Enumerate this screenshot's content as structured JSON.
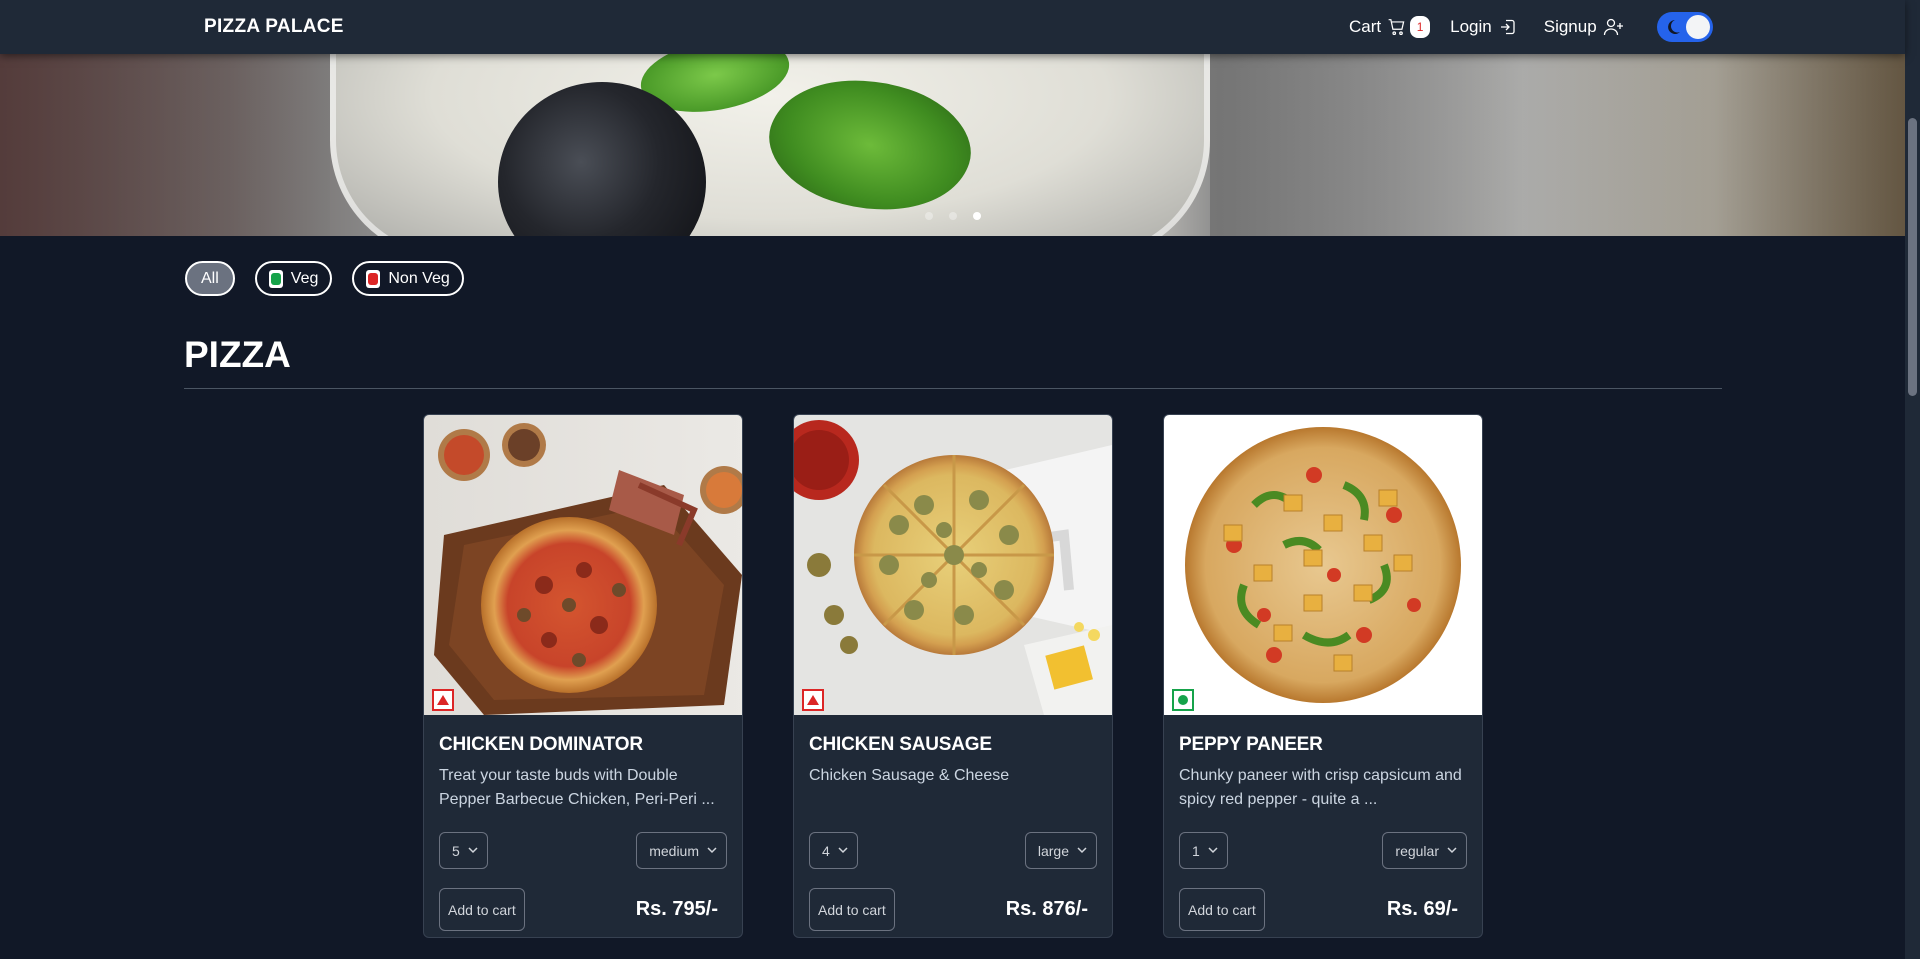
{
  "app": {
    "brand": "PIZZA PALACE"
  },
  "nav": {
    "cart_label": "Cart",
    "cart_count": "1",
    "login_label": "Login",
    "signup_label": "Signup",
    "theme_toggle": "dark"
  },
  "carousel": {
    "slide_count": 3,
    "active_index": 2
  },
  "filters": [
    {
      "label": "All",
      "active": true
    },
    {
      "label": "Veg",
      "mark": "veg"
    },
    {
      "label": "Non Veg",
      "mark": "nonveg"
    }
  ],
  "section": {
    "title": "PIZZA"
  },
  "products": [
    {
      "name": "CHICKEN DOMINATOR",
      "description": "Treat your taste buds with Double Pepper Barbecue Chicken, Peri-Peri ...",
      "quantity": "5",
      "size": "medium",
      "add_label": "Add to cart",
      "price": "Rs. 795/-",
      "type": "nonveg"
    },
    {
      "name": "CHICKEN SAUSAGE",
      "description": "Chicken Sausage & Cheese",
      "quantity": "4",
      "size": "large",
      "add_label": "Add to cart",
      "price": "Rs. 876/-",
      "type": "nonveg"
    },
    {
      "name": "PEPPY PANEER",
      "description": "Chunky paneer with crisp capsicum and spicy red pepper - quite a ...",
      "quantity": "1",
      "size": "regular",
      "add_label": "Add to cart",
      "price": "Rs. 69/-",
      "type": "veg"
    }
  ],
  "colors": {
    "background": "#111827",
    "navbar": "#1f2937",
    "card": "#1f2937",
    "toggle": "#2563eb",
    "veg": "#16a34a",
    "nonveg": "#dc2626"
  }
}
